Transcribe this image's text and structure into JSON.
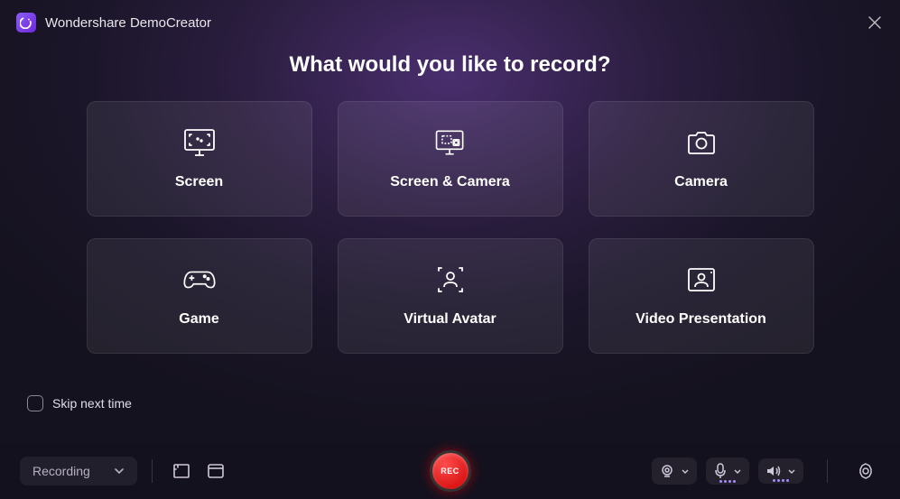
{
  "app": {
    "title": "Wondershare DemoCreator"
  },
  "heading": "What would you like to record?",
  "cards": [
    {
      "label": "Screen"
    },
    {
      "label": "Screen & Camera"
    },
    {
      "label": "Camera"
    },
    {
      "label": "Game"
    },
    {
      "label": "Virtual Avatar"
    },
    {
      "label": "Video Presentation"
    }
  ],
  "skip": {
    "label": "Skip next time",
    "checked": false
  },
  "bottombar": {
    "mode_dropdown": "Recording",
    "rec_label": "REC"
  }
}
